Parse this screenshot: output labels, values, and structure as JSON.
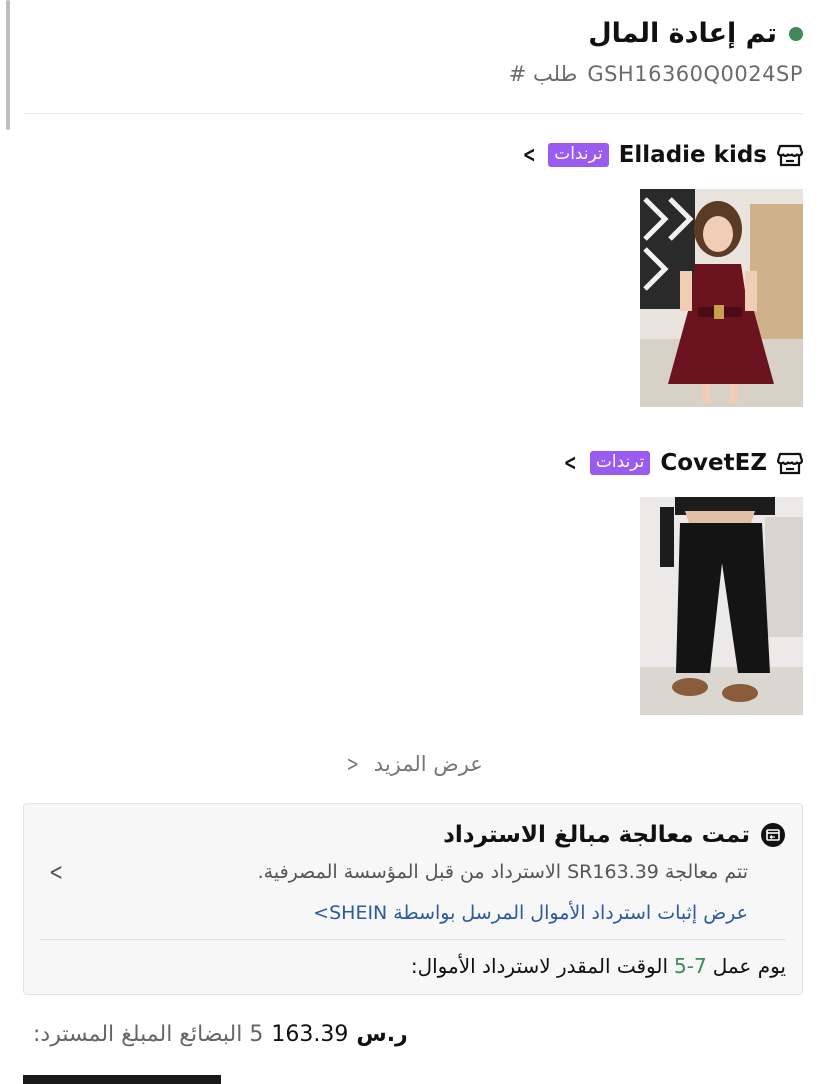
{
  "header": {
    "status_title": "تم إعادة المال",
    "order_label": "طلب #",
    "order_number": "GSH16360Q0024SP",
    "status_color": "#3f8a57"
  },
  "stores": [
    {
      "name": "Elladie kids",
      "badge": "ترندات",
      "icon": "store-icon",
      "product": "burgundy-dress"
    },
    {
      "name": "CovetEZ",
      "badge": "ترندات",
      "icon": "store-icon",
      "product": "black-pants"
    }
  ],
  "more": {
    "label": "عرض المزيد",
    "chevron": "<"
  },
  "refund": {
    "icon": "refund-icon",
    "title": "تمت معالجة مبالغ الاسترداد",
    "description": "تتم معالجة SR163.39 الاسترداد من قبل المؤسسة المصرفية.",
    "proof_link": "عرض إثبات استرداد الأموال المرسل بواسطة SHEIN>",
    "chevron": "<",
    "eta_label": "الوقت المقدر لاسترداد الأموال:",
    "eta_days": "5-7",
    "eta_unit": "يوم عمل"
  },
  "summary": {
    "items_label": "5 البضائع المبلغ المسترد:",
    "amount": "163.39",
    "currency": "ر.س"
  },
  "colors": {
    "badge": "#9a5cf0",
    "link": "#2c5aa0",
    "green": "#3f8a57"
  }
}
